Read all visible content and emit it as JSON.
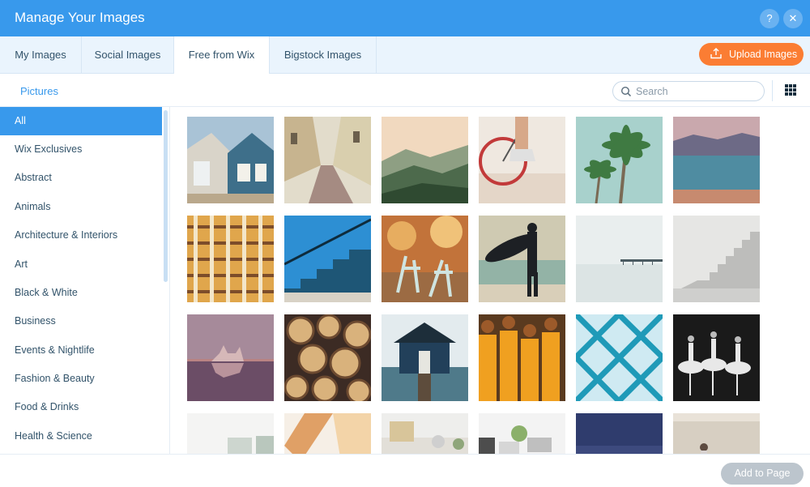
{
  "window": {
    "title": "Manage Your Images"
  },
  "tabs": [
    {
      "label": "My Images"
    },
    {
      "label": "Social Images"
    },
    {
      "label": "Free from Wix"
    },
    {
      "label": "Bigstock Images"
    }
  ],
  "active_tab": "Free from Wix",
  "upload_button": {
    "label": "Upload Images"
  },
  "breadcrumb": "Pictures",
  "search": {
    "placeholder": "Search",
    "value": ""
  },
  "categories": [
    {
      "label": "All"
    },
    {
      "label": "Wix Exclusives"
    },
    {
      "label": "Abstract"
    },
    {
      "label": "Animals"
    },
    {
      "label": "Architecture & Interiors"
    },
    {
      "label": "Art"
    },
    {
      "label": "Black & White"
    },
    {
      "label": "Business"
    },
    {
      "label": "Events & Nightlife"
    },
    {
      "label": "Fashion & Beauty"
    },
    {
      "label": "Food & Drinks"
    },
    {
      "label": "Health & Science"
    }
  ],
  "active_category": "All",
  "footer": {
    "add_button_label": "Add to Page"
  },
  "icons": {
    "help": "help-icon",
    "close": "close-icon",
    "upload": "upload-icon",
    "search": "search-icon",
    "grid_view": "grid-view-icon"
  },
  "colors": {
    "header": "#3899ec",
    "accent": "#3899ec",
    "upload_button": "#fb7d33",
    "disabled_button": "#bcc5cd"
  },
  "help_glyph": "?",
  "close_glyph": "✕"
}
